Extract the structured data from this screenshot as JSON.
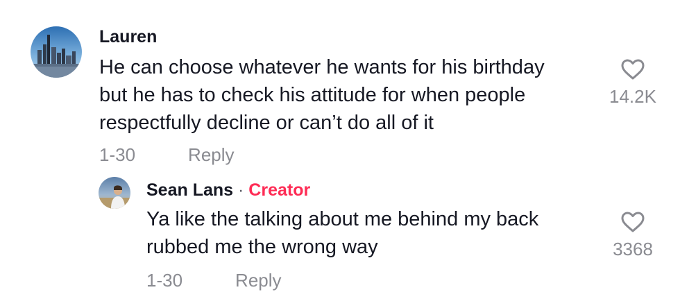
{
  "comments": [
    {
      "username": "Lauren",
      "text_lines": [
        "He can choose whatever he wants for his birthday",
        "but he has to check his attitude for when people",
        "respectfully decline or can’t do all of it"
      ],
      "date": "1-30",
      "reply_label": "Reply",
      "likes": "14.2K",
      "avatar_icon": "city-skyline-avatar"
    },
    {
      "username": "Sean Lans",
      "separator": " · ",
      "badge": "Creator",
      "text_lines": [
        "Ya like the talking about me behind my back",
        "rubbed me the wrong way"
      ],
      "date": "1-30",
      "reply_label": "Reply",
      "likes": "3368",
      "avatar_icon": "person-photo-avatar"
    }
  ],
  "colors": {
    "text": "#161823",
    "muted": "#8a8b91",
    "creator": "#fe2c55"
  },
  "icons": {
    "like": "heart-outline-icon"
  }
}
